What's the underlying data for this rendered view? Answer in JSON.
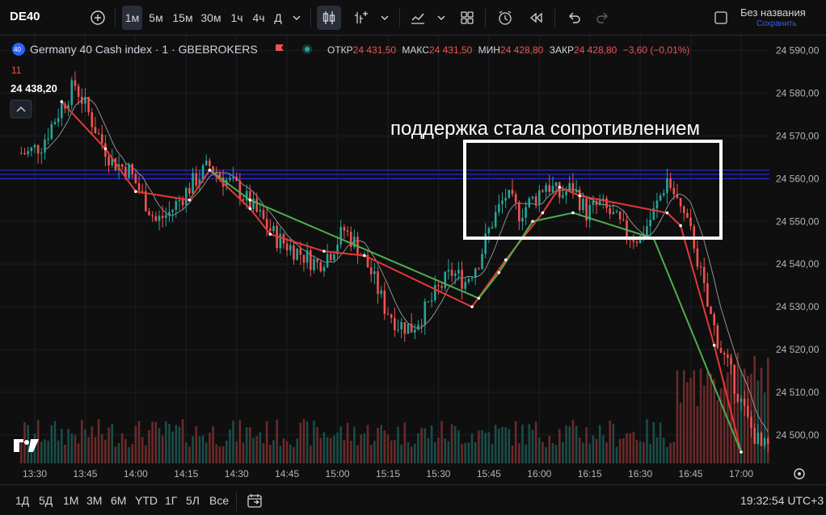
{
  "toolbar": {
    "symbol": "DE40",
    "intervals": [
      "1м",
      "5м",
      "15м",
      "30м",
      "1ч",
      "4ч",
      "Д"
    ],
    "active_interval": "1м",
    "layout_title": "Без названия",
    "save_label": "Сохранить"
  },
  "legend": {
    "instrument": "Germany 40 Cash index · 1 · GBEBROKERS",
    "open_label": "ОТКР",
    "open": "24 431,50",
    "high_label": "МАКС",
    "high": "24 431,50",
    "low_label": "МИН",
    "low": "24 428,80",
    "close_label": "ЗАКР",
    "close": "24 428,80",
    "change": "−3,60 (−0,01%)",
    "volume_count": "11",
    "cursor_price": "24 438,20"
  },
  "annotation": {
    "text": "поддержка стала сопротивлением"
  },
  "bottombar": {
    "ranges": [
      "1Д",
      "5Д",
      "1М",
      "3М",
      "6М",
      "YTD",
      "1Г",
      "5Л",
      "Все"
    ],
    "clock": "19:32:54 UTC+3"
  },
  "colors": {
    "up": "#26a69a",
    "down": "#ef5350",
    "background": "#0f0f0f",
    "zigzag_red": "#e53935",
    "zigzag_green": "#4caf50",
    "level_lines": "#2c2cff",
    "annotation_box": "#ffffff"
  },
  "chart_data": {
    "type": "candlestick",
    "y_ticks": [
      24500,
      24510,
      24520,
      24530,
      24540,
      24550,
      24560,
      24570,
      24580,
      24590
    ],
    "y_tick_labels": [
      "24 500,00",
      "24 510,00",
      "24 520,00",
      "24 530,00",
      "24 540,00",
      "24 550,00",
      "24 560,00",
      "24 570,00",
      "24 580,00",
      "24 590,00"
    ],
    "ylim": [
      24496,
      24592
    ],
    "x_labels": [
      "13:30",
      "13:45",
      "14:00",
      "14:15",
      "14:30",
      "14:45",
      "15:00",
      "15:15",
      "15:30",
      "15:45",
      "16:00",
      "16:15",
      "16:30",
      "16:45",
      "17:00"
    ],
    "x_start_minutes": 810,
    "x_end_minutes": 1026,
    "resistance_levels": [
      24562,
      24561,
      24560
    ],
    "price_path": [
      [
        808,
        24566
      ],
      [
        812,
        24568
      ],
      [
        818,
        24577
      ],
      [
        822,
        24582
      ],
      [
        825,
        24577
      ],
      [
        829,
        24570
      ],
      [
        833,
        24564
      ],
      [
        838,
        24562
      ],
      [
        842,
        24556
      ],
      [
        846,
        24550
      ],
      [
        850,
        24552
      ],
      [
        854,
        24556
      ],
      [
        858,
        24560
      ],
      [
        862,
        24563
      ],
      [
        866,
        24560
      ],
      [
        870,
        24558
      ],
      [
        874,
        24554
      ],
      [
        878,
        24550
      ],
      [
        882,
        24546
      ],
      [
        886,
        24544
      ],
      [
        890,
        24542
      ],
      [
        894,
        24540
      ],
      [
        898,
        24543
      ],
      [
        902,
        24548
      ],
      [
        906,
        24544
      ],
      [
        910,
        24538
      ],
      [
        914,
        24530
      ],
      [
        918,
        24526
      ],
      [
        922,
        24525
      ],
      [
        926,
        24529
      ],
      [
        930,
        24534
      ],
      [
        934,
        24538
      ],
      [
        938,
        24536
      ],
      [
        942,
        24541
      ],
      [
        946,
        24550
      ],
      [
        950,
        24556
      ],
      [
        954,
        24552
      ],
      [
        958,
        24555
      ],
      [
        962,
        24559
      ],
      [
        966,
        24556
      ],
      [
        970,
        24558
      ],
      [
        974,
        24552
      ],
      [
        978,
        24554
      ],
      [
        982,
        24551
      ],
      [
        986,
        24547
      ],
      [
        990,
        24546
      ],
      [
        994,
        24552
      ],
      [
        998,
        24560
      ],
      [
        1002,
        24553
      ],
      [
        1006,
        24545
      ],
      [
        1010,
        24530
      ],
      [
        1014,
        24520
      ],
      [
        1018,
        24512
      ],
      [
        1022,
        24503
      ],
      [
        1026,
        24497
      ]
    ],
    "zigzag_red": [
      [
        818,
        24578
      ],
      [
        831,
        24567
      ],
      [
        840,
        24557
      ],
      [
        856,
        24555
      ],
      [
        862,
        24562
      ],
      [
        874,
        24553
      ],
      [
        880,
        24547
      ],
      [
        896,
        24543
      ],
      [
        908,
        24542
      ],
      [
        940,
        24530
      ],
      [
        950,
        24541
      ],
      [
        961,
        24552
      ],
      [
        966,
        24558
      ],
      [
        972,
        24556
      ],
      [
        998,
        24552
      ],
      [
        1002,
        24549
      ],
      [
        1012,
        24521
      ],
      [
        1020,
        24496
      ]
    ],
    "zigzag_green": [
      [
        862,
        24562
      ],
      [
        874,
        24555
      ],
      [
        942,
        24532
      ],
      [
        948,
        24538
      ],
      [
        958,
        24550
      ],
      [
        970,
        24552
      ],
      [
        994,
        24546
      ],
      [
        1020,
        24496
      ]
    ]
  }
}
